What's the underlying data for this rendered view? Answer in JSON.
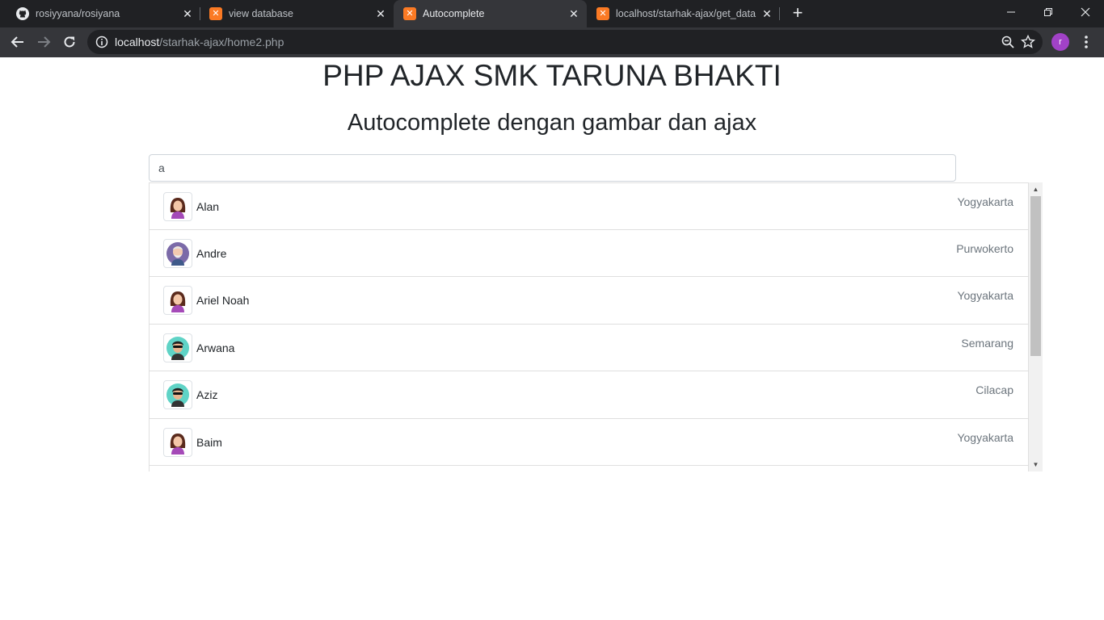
{
  "browser": {
    "tabs": [
      {
        "title": "rosiyyana/rosiyana",
        "icon": "github-icon",
        "active": false
      },
      {
        "title": "view database",
        "icon": "xampp-icon",
        "active": false
      },
      {
        "title": "Autocomplete",
        "icon": "xampp-icon",
        "active": true
      },
      {
        "title": "localhost/starhak-ajax/get_data.p",
        "icon": "xampp-icon",
        "active": false
      }
    ],
    "url_host": "localhost",
    "url_path": "/starhak-ajax/home2.php",
    "profile_initial": "r"
  },
  "page": {
    "title": "PHP AJAX SMK TARUNA BHAKTI",
    "subtitle": "Autocomplete dengan gambar dan ajax",
    "search_value": "a"
  },
  "results": [
    {
      "name": "Alan",
      "city": "Yogyakarta",
      "avatar": "female-avatar-icon"
    },
    {
      "name": "Andre",
      "city": "Purwokerto",
      "avatar": "elderly-man-avatar-icon"
    },
    {
      "name": "Ariel Noah",
      "city": "Yogyakarta",
      "avatar": "female-avatar-icon"
    },
    {
      "name": "Arwana",
      "city": "Semarang",
      "avatar": "male-sunglasses-avatar-icon"
    },
    {
      "name": "Aziz",
      "city": "Cilacap",
      "avatar": "male-sunglasses-avatar-icon"
    },
    {
      "name": "Baim",
      "city": "Yogyakarta",
      "avatar": "female-avatar-icon"
    }
  ],
  "colors": {
    "tabstrip_bg": "#202124",
    "toolbar_bg": "#35363a",
    "profile": "#a142c7",
    "xampp": "#fb7a24"
  }
}
